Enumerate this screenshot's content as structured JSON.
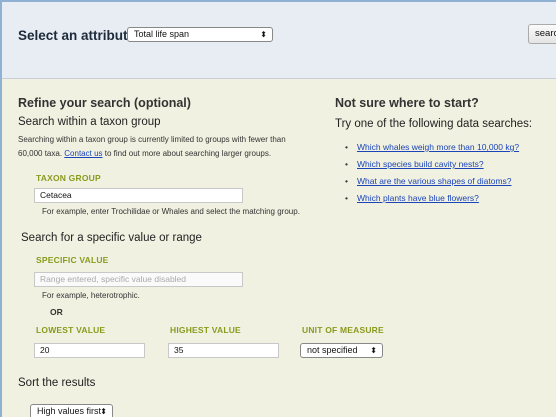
{
  "attribute": {
    "label": "Select an attribute",
    "selected": "Total life span",
    "search_button": "search"
  },
  "refine": {
    "title": "Refine your search (optional)",
    "taxon_heading": "Search within a taxon group",
    "taxon_note_1": "Searching within a taxon group is currently limited to groups with fewer than",
    "taxon_note_2_prefix": "60,000 taxa.",
    "taxon_note_link": "Contact us",
    "taxon_note_2_suffix": "to find out more about searching larger groups.",
    "taxon_group_label": "TAXON GROUP",
    "taxon_group_value": "Cetacea",
    "taxon_example": "For example, enter Trochilidae or Whales and select the matching group.",
    "value_heading": "Search for a specific value or range",
    "specific_value_label": "SPECIFIC VALUE",
    "specific_value_placeholder": "Range entered, specific value disabled",
    "specific_example": "For example, heterotrophic.",
    "or_label": "OR",
    "lowest_label": "LOWEST VALUE",
    "lowest_value": "20",
    "highest_label": "HIGHEST VALUE",
    "highest_value": "35",
    "unit_label": "UNIT OF MEASURE",
    "unit_selected": "not specified",
    "sort_heading": "Sort the results",
    "sort_selected": "High values first"
  },
  "help": {
    "title": "Not sure where to start?",
    "subtitle": "Try one of the following data searches:",
    "links": [
      "Which whales weigh more than 10,000 kg?",
      "Which species build cavity nests?",
      "What are the various shapes of diatoms?",
      "Which plants have blue flowers?"
    ]
  }
}
